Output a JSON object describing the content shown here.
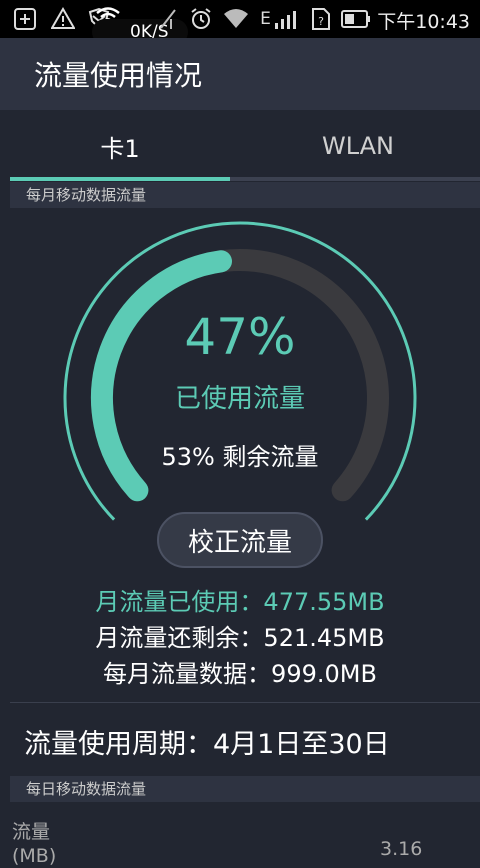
{
  "status_bar": {
    "speed": "0K/S",
    "time": "下午10:43",
    "network": "E",
    "icons": [
      "add-icon",
      "warning-icon",
      "shield-icon",
      "wifi-icon",
      "signal-muted-icon",
      "alarm-icon",
      "wifi-icon",
      "signal-icon",
      "sim-icon",
      "battery-icon"
    ]
  },
  "header": {
    "title": "流量使用情况"
  },
  "tabs": [
    {
      "label": "卡1",
      "selected": true
    },
    {
      "label": "WLAN",
      "selected": false
    }
  ],
  "monthly_label": "每月移动数据流量",
  "gauge": {
    "percent_text": "47%",
    "percent_value": 47,
    "used_label": "已使用流量",
    "remaining_text": "53% 剩余流量",
    "accent": "#5ccbb5",
    "track": "#3a3a3e"
  },
  "calibrate_button": "校正流量",
  "stats": {
    "used": "月流量已使用：477.55MB",
    "remaining": "月流量还剩余：521.45MB",
    "total": "每月流量数据：999.0MB"
  },
  "cycle": "流量使用周期：4月1日至30日",
  "daily_label": "每日移动数据流量",
  "daily_chart": {
    "y_label_1": "流量",
    "y_label_2": "(MB)",
    "value_label": "3.16"
  }
}
